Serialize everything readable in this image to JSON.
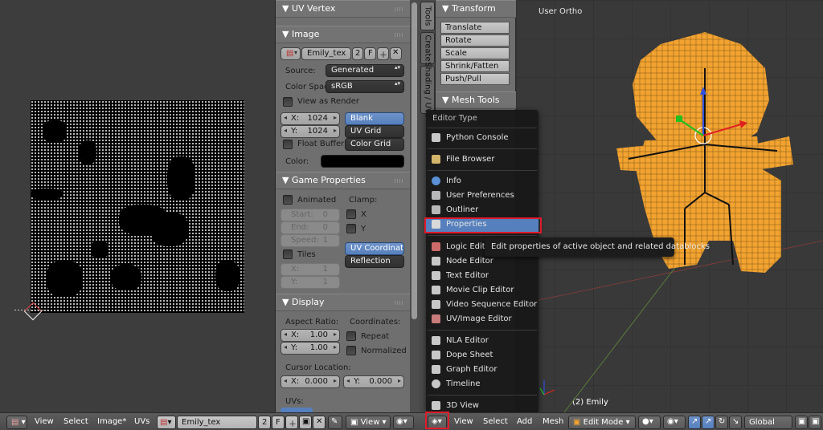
{
  "uv_editor": {
    "bottom_menu": [
      "View",
      "Select",
      "Image*",
      "UVs"
    ],
    "image_name": "Emily_tex",
    "users": "2",
    "fake_user": "F",
    "display_mode": "View"
  },
  "properties": {
    "uv_vertex_header": "UV Vertex",
    "image_header": "Image",
    "image_name": "Emily_tex",
    "users": "2",
    "fake_user": "F",
    "source_label": "Source:",
    "source_value": "Generated",
    "color_space_label": "Color Spac",
    "color_space_value": "sRGB",
    "view_as_render": "View as Render",
    "x_label": "X:",
    "x_value": "1024",
    "y_label": "Y:",
    "y_value": "1024",
    "float_buffer": "Float Buffer",
    "gen_types": [
      "Blank",
      "UV Grid",
      "Color Grid"
    ],
    "color_label": "Color:",
    "color_value": "#000000",
    "game_header": "Game Properties",
    "animated": "Animated",
    "clamp_label": "Clamp:",
    "clamp_x": "X",
    "clamp_y": "Y",
    "start_label": "Start:",
    "start_value": "0",
    "end_label": "End:",
    "end_value": "0",
    "speed_label": "Speed:",
    "speed_value": "1",
    "tiles": "Tiles",
    "tiles_x_value": "1",
    "tiles_y_value": "1",
    "mapping": [
      "UV Coordinat…",
      "Reflection"
    ],
    "display_header": "Display",
    "aspect_label": "Aspect Ratio:",
    "aspect_x": "1.00",
    "aspect_y": "1.00",
    "coords_label": "Coordinates:",
    "repeat": "Repeat",
    "normalized": "Normalized",
    "cursor_label": "Cursor Location:",
    "cursor_x": "0.000",
    "cursor_y": "0.000",
    "uvs_label": "UVs:"
  },
  "tool_tabs": [
    "Tools",
    "Create",
    "Shading / UVs"
  ],
  "tool_shelf": {
    "transform_header": "Transform",
    "buttons": [
      "Translate",
      "Rotate",
      "Scale",
      "Shrink/Fatten",
      "Push/Pull"
    ],
    "mesh_tools_header": "Mesh Tools"
  },
  "viewport": {
    "view_label": "User Ortho",
    "object_label": "(2) Emily",
    "bottom_menu": [
      "View",
      "Select",
      "Add",
      "Mesh"
    ],
    "mode": "Edit Mode",
    "orientation": "Global"
  },
  "editor_menu": {
    "title": "Editor Type",
    "items": [
      {
        "label": "Python Console",
        "icon": "python-console-icon",
        "color": "#c8c8c8"
      },
      {
        "label": "File Browser",
        "icon": "file-browser-icon",
        "color": "#d4b56a"
      },
      {
        "label": "Info",
        "icon": "info-icon",
        "color": "#5b8fd6"
      },
      {
        "label": "User Preferences",
        "icon": "user-preferences-icon",
        "color": "#b8b8b8"
      },
      {
        "label": "Outliner",
        "icon": "outliner-icon",
        "color": "#b8b8b8"
      },
      {
        "label": "Properties",
        "icon": "properties-icon",
        "color": "#d9d9d9"
      },
      {
        "label": "Logic Editor",
        "icon": "logic-editor-icon",
        "color": "#cc6a6a"
      },
      {
        "label": "Node Editor",
        "icon": "node-editor-icon",
        "color": "#c8c8c8"
      },
      {
        "label": "Text Editor",
        "icon": "text-editor-icon",
        "color": "#c8c8c8"
      },
      {
        "label": "Movie Clip Editor",
        "icon": "movie-clip-editor-icon",
        "color": "#c8c8c8"
      },
      {
        "label": "Video Sequence Editor",
        "icon": "video-sequence-editor-icon",
        "color": "#c8c8c8"
      },
      {
        "label": "UV/Image Editor",
        "icon": "uv-image-editor-icon",
        "color": "#c97b7b"
      },
      {
        "label": "NLA Editor",
        "icon": "nla-editor-icon",
        "color": "#c8c8c8"
      },
      {
        "label": "Dope Sheet",
        "icon": "dope-sheet-icon",
        "color": "#c8c8c8"
      },
      {
        "label": "Graph Editor",
        "icon": "graph-editor-icon",
        "color": "#c8c8c8"
      },
      {
        "label": "Timeline",
        "icon": "timeline-icon",
        "color": "#c8c8c8"
      },
      {
        "label": "3D View",
        "icon": "3d-view-icon",
        "color": "#c8c8c8"
      }
    ],
    "highlighted": "Properties",
    "tooltip": "Edit properties of active object and related datablocks"
  },
  "colors": {
    "highlight_box": "#e01a2a",
    "menu_selected": "#5680bd",
    "mesh_orange": "#f2a330"
  }
}
